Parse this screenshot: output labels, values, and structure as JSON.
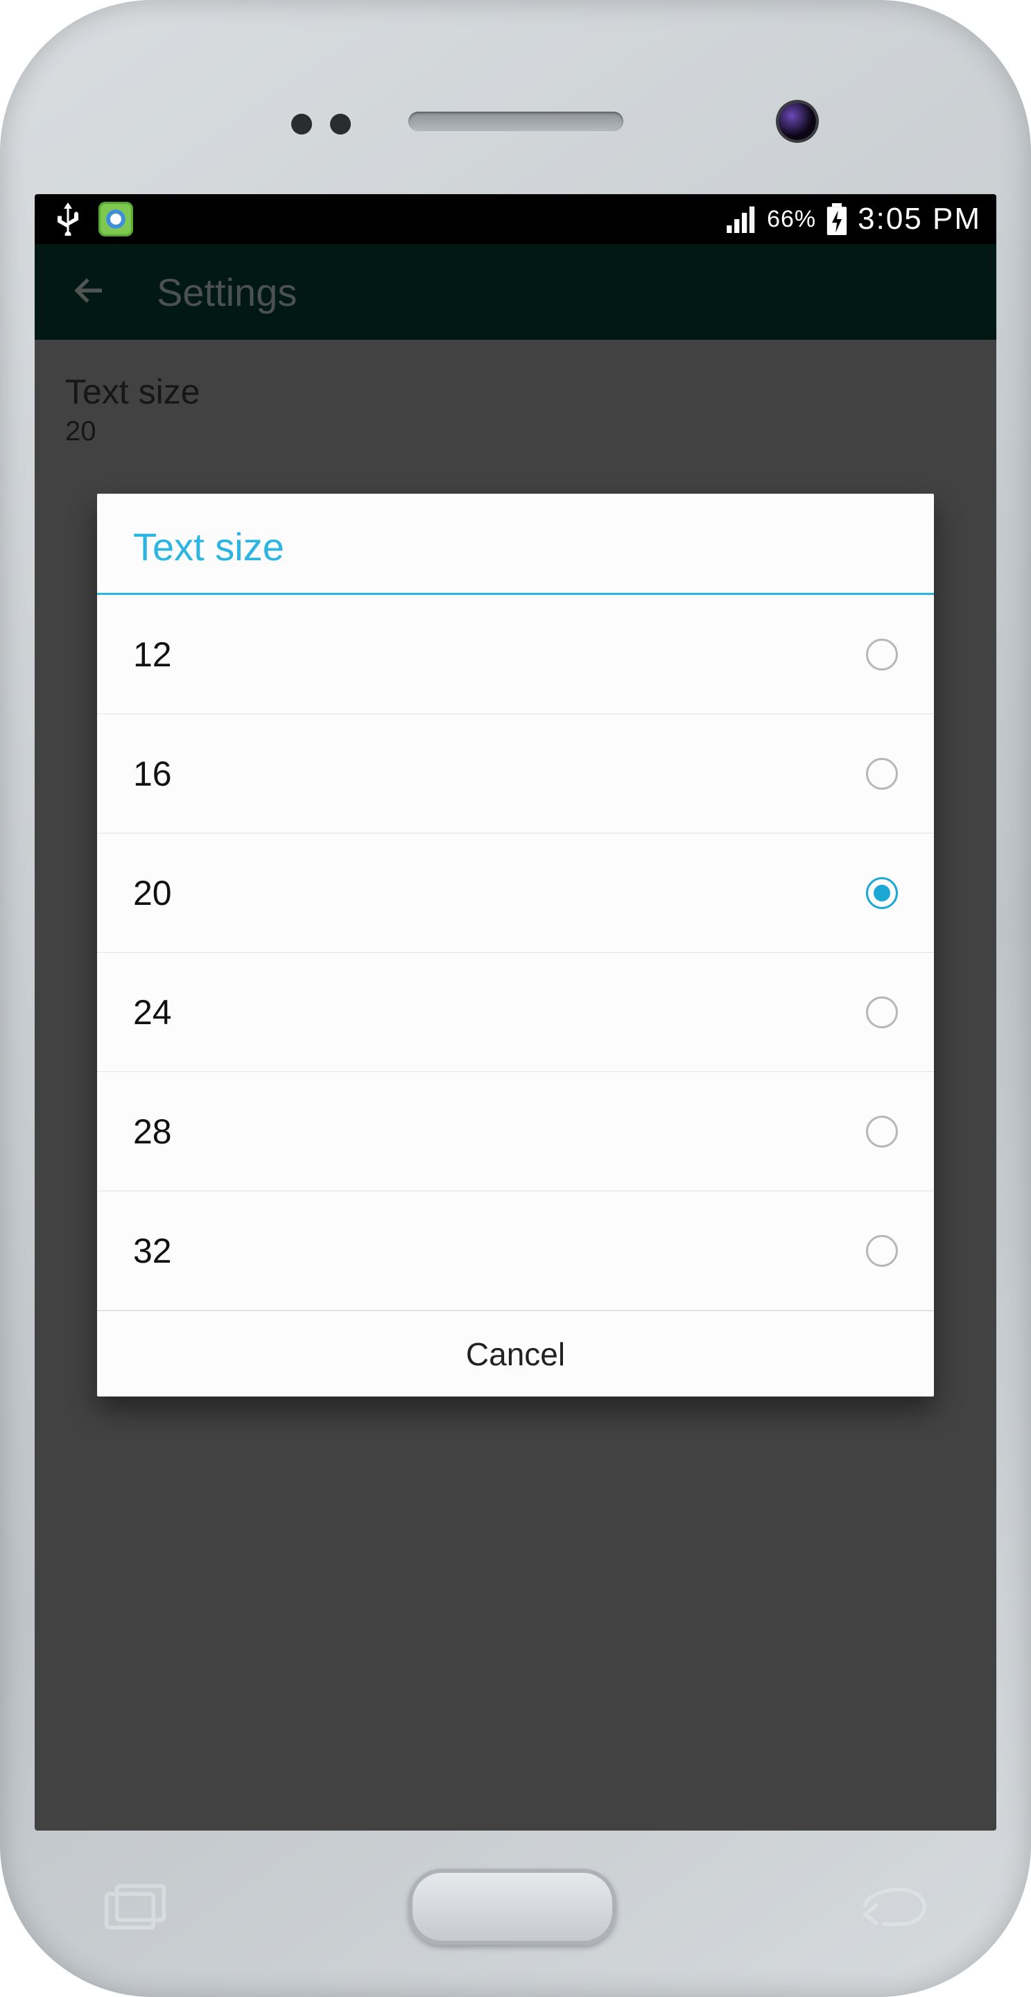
{
  "status_bar": {
    "battery_pct": "66%",
    "time": "3:05 PM"
  },
  "header": {
    "title": "Settings"
  },
  "background": {
    "label": "Text size",
    "value": "20"
  },
  "dialog": {
    "title": "Text size",
    "options": [
      {
        "label": "12",
        "selected": false
      },
      {
        "label": "16",
        "selected": false
      },
      {
        "label": "20",
        "selected": true
      },
      {
        "label": "24",
        "selected": false
      },
      {
        "label": "28",
        "selected": false
      },
      {
        "label": "32",
        "selected": false
      }
    ],
    "cancel_label": "Cancel"
  }
}
